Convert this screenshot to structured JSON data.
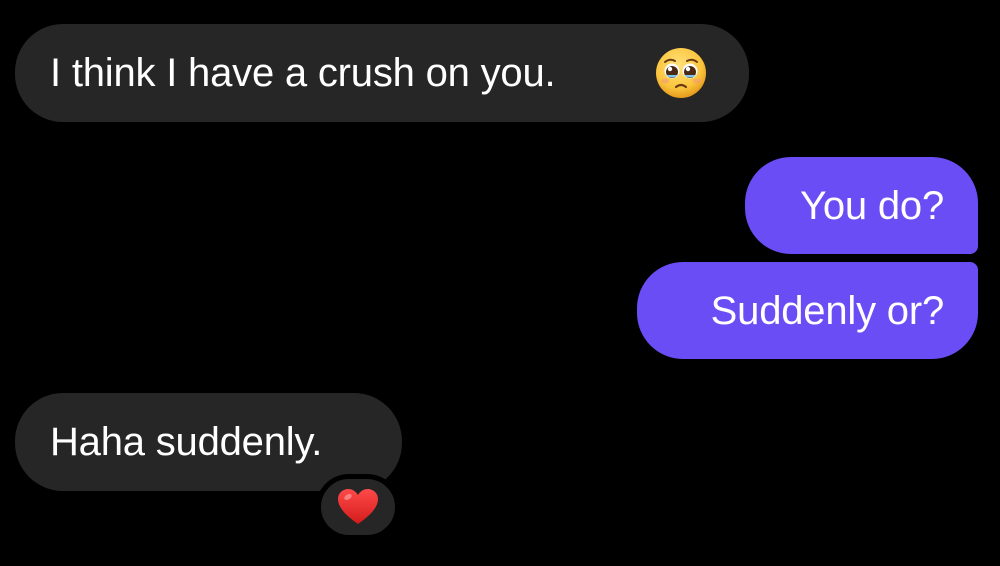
{
  "conversation": {
    "messages": [
      {
        "direction": "incoming",
        "text": "I think I have a crush on you.",
        "emoji": "pleading-face-icon"
      },
      {
        "direction": "outgoing",
        "text": "You do?"
      },
      {
        "direction": "outgoing",
        "text": "Suddenly or?"
      },
      {
        "direction": "incoming",
        "text": "Haha suddenly.",
        "reaction": "red-heart-icon"
      }
    ]
  },
  "colors": {
    "background": "#000000",
    "incoming_bubble": "#262626",
    "outgoing_bubble": "#6b4df5",
    "text": "#ffffff"
  }
}
